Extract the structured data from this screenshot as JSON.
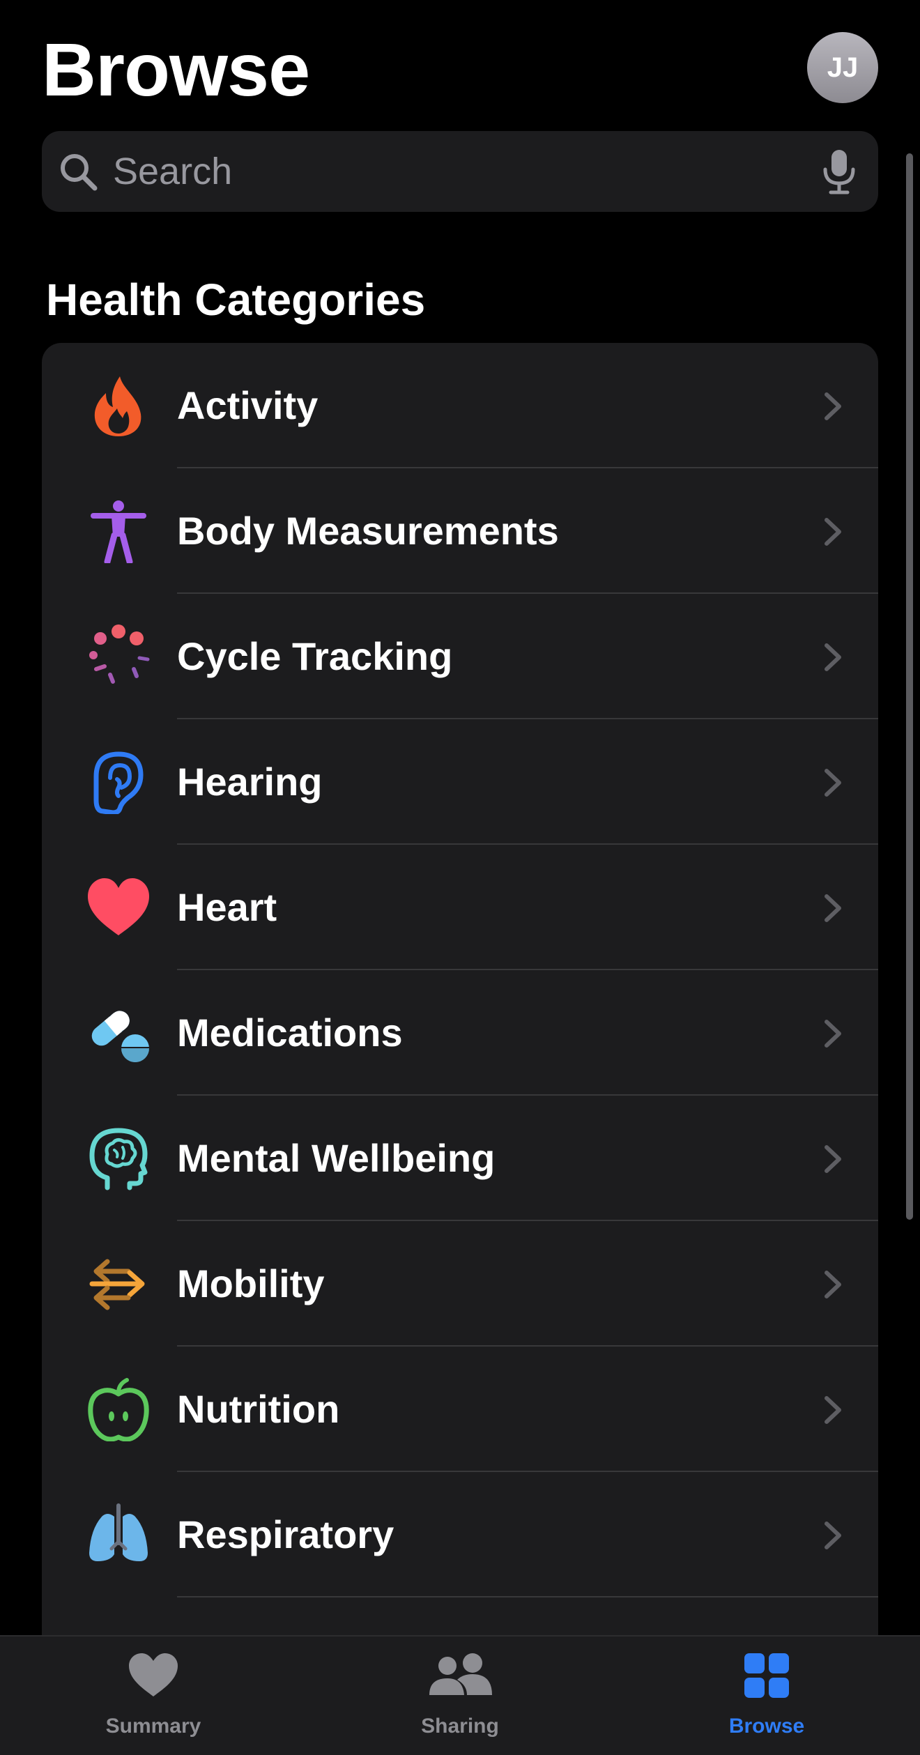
{
  "header": {
    "title": "Browse",
    "avatar_initials": "JJ"
  },
  "search": {
    "placeholder": "Search",
    "value": ""
  },
  "section": {
    "title": "Health Categories"
  },
  "categories": [
    {
      "label": "Activity",
      "icon": "flame-icon",
      "color": "#f25c2a"
    },
    {
      "label": "Body Measurements",
      "icon": "figure-icon",
      "color": "#a55eea"
    },
    {
      "label": "Cycle Tracking",
      "icon": "cycle-dots-icon",
      "color": "#e0607e"
    },
    {
      "label": "Hearing",
      "icon": "ear-icon",
      "color": "#2f7bf5"
    },
    {
      "label": "Heart",
      "icon": "heart-icon",
      "color": "#ff4d63"
    },
    {
      "label": "Medications",
      "icon": "pills-icon",
      "color": "#6fc8f2"
    },
    {
      "label": "Mental Wellbeing",
      "icon": "mind-head-icon",
      "color": "#66d7d1"
    },
    {
      "label": "Mobility",
      "icon": "arrows-icon",
      "color": "#f5a53a"
    },
    {
      "label": "Nutrition",
      "icon": "apple-icon",
      "color": "#5cc85c"
    },
    {
      "label": "Respiratory",
      "icon": "lungs-icon",
      "color": "#6cb6ea"
    }
  ],
  "tabs": [
    {
      "label": "Summary",
      "icon": "heart-tab-icon",
      "active": false
    },
    {
      "label": "Sharing",
      "icon": "people-icon",
      "active": false
    },
    {
      "label": "Browse",
      "icon": "grid-icon",
      "active": true
    }
  ],
  "colors": {
    "background": "#000000",
    "card": "#1c1c1e",
    "accent": "#2f7df6",
    "inactive_tab": "#8e8e93",
    "chevron": "#5e5e63"
  }
}
